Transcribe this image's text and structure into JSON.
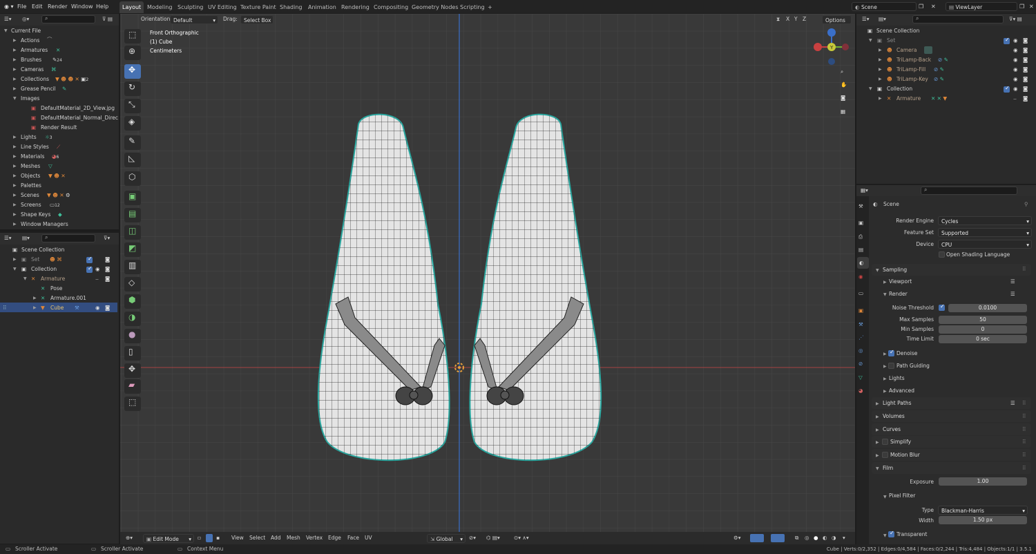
{
  "menu": [
    "File",
    "Edit",
    "Render",
    "Window",
    "Help"
  ],
  "workspace_tabs": [
    "Layout",
    "Modeling",
    "Sculpting",
    "UV Editing",
    "Texture Paint",
    "Shading",
    "Animation",
    "Rendering",
    "Compositing",
    "Geometry Nodes",
    "Scripting"
  ],
  "workspace_add": "+",
  "scene_selector": "Scene",
  "view_layer_selector": "ViewLayer",
  "outliner_top": {
    "root": "Current File",
    "items": [
      {
        "label": "Actions",
        "count": ""
      },
      {
        "label": "Armatures",
        "count": ""
      },
      {
        "label": "Brushes",
        "count": "24"
      },
      {
        "label": "Cameras",
        "count": ""
      },
      {
        "label": "Collections",
        "count": "2"
      },
      {
        "label": "Grease Pencil",
        "count": ""
      },
      {
        "label": "Images",
        "count": ""
      },
      {
        "label": "DefaultMaterial_2D_View.jpg",
        "count": ""
      },
      {
        "label": "DefaultMaterial_Normal_DirectX.jp",
        "count": ""
      },
      {
        "label": "Render Result",
        "count": ""
      },
      {
        "label": "Lights",
        "count": "3"
      },
      {
        "label": "Line Styles",
        "count": ""
      },
      {
        "label": "Materials",
        "count": "6"
      },
      {
        "label": "Meshes",
        "count": ""
      },
      {
        "label": "Objects",
        "count": ""
      },
      {
        "label": "Palettes",
        "count": ""
      },
      {
        "label": "Scenes",
        "count": ""
      },
      {
        "label": "Screens",
        "count": "12"
      },
      {
        "label": "Shape Keys",
        "count": ""
      },
      {
        "label": "Window Managers",
        "count": ""
      }
    ]
  },
  "outliner_left": {
    "items": [
      "Scene Collection",
      "Set",
      "Collection",
      "Armature",
      "Pose",
      "Armature.001",
      "Cube"
    ]
  },
  "outliner_right": {
    "items": [
      "Scene Collection",
      "Set",
      "Camera",
      "TriLamp-Back",
      "TriLamp-Fill",
      "TriLamp-Key",
      "Collection",
      "Armature"
    ]
  },
  "viewport_header": {
    "orientation_label": "Orientation:",
    "orientation_value": "Default",
    "drag_label": "Drag:",
    "drag_value": "Select Box",
    "axes": [
      "X",
      "Y",
      "Z"
    ],
    "options": "Options"
  },
  "viewport_overlay": {
    "view_name": "Front Orthographic",
    "object": "(1) Cube",
    "units": "Centimeters"
  },
  "viewport_footer": {
    "mode": "Edit Mode",
    "menus": [
      "View",
      "Select",
      "Add",
      "Mesh",
      "Vertex",
      "Edge",
      "Face",
      "UV"
    ],
    "transform": "Global"
  },
  "properties": {
    "scene_name": "Scene",
    "render_engine_label": "Render Engine",
    "render_engine": "Cycles",
    "feature_set_label": "Feature Set",
    "feature_set": "Supported",
    "device_label": "Device",
    "device": "CPU",
    "osl_label": "Open Shading Language",
    "sampling": "Sampling",
    "viewport": "Viewport",
    "render": "Render",
    "noise_threshold_label": "Noise Threshold",
    "noise_threshold": "0.0100",
    "max_samples_label": "Max Samples",
    "max_samples": "50",
    "min_samples_label": "Min Samples",
    "min_samples": "0",
    "time_limit_label": "Time Limit",
    "time_limit": "0 sec",
    "denoise": "Denoise",
    "path_guiding": "Path Guiding",
    "lights": "Lights",
    "advanced": "Advanced",
    "light_paths": "Light Paths",
    "volumes": "Volumes",
    "curves": "Curves",
    "simplify": "Simplify",
    "motion_blur": "Motion Blur",
    "film": "Film",
    "exposure_label": "Exposure",
    "exposure": "1.00",
    "pixel_filter": "Pixel Filter",
    "type_label": "Type",
    "type": "Blackman-Harris",
    "width_label": "Width",
    "width": "1.50 px",
    "transparent": "Transparent"
  },
  "status_bar": {
    "left1": "Scroller Activate",
    "left2": "Scroller Activate",
    "left3": "Context Menu",
    "stats": "Cube | Verts:0/2,352 | Edges:0/4,584 | Faces:0/2,244 | Tris:4,484 | Objects:1/1 | 3.5.1"
  },
  "colors": {
    "accent": "#4772b3",
    "x_axis": "#c94040",
    "z_axis": "#3a6fc9",
    "wire": "#1a1a1a"
  }
}
